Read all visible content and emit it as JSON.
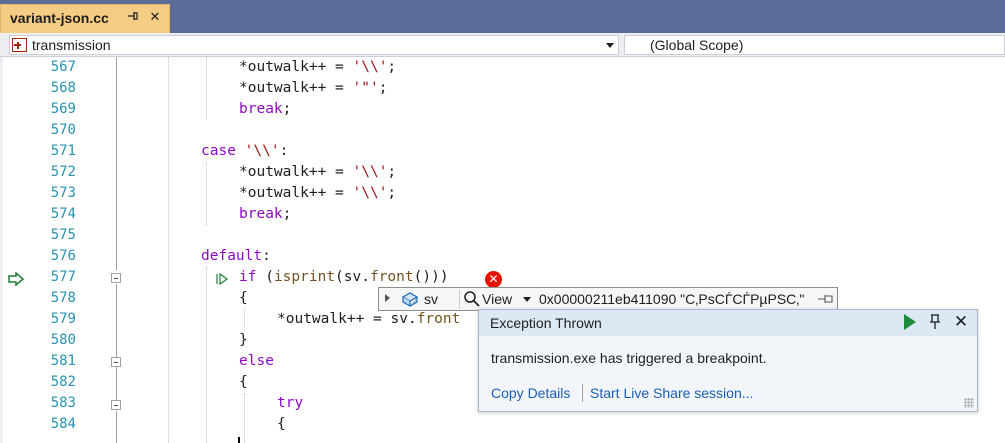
{
  "tab": {
    "title": "variant-json.cc",
    "pin_glyph": "⊣",
    "close_glyph": "✕"
  },
  "navbar": {
    "left_value": "transmission",
    "right_value": "(Global Scope)"
  },
  "line_numbers": [
    "567",
    "568",
    "569",
    "570",
    "571",
    "572",
    "573",
    "574",
    "575",
    "576",
    "577",
    "578",
    "579",
    "580",
    "581",
    "582",
    "583",
    "584"
  ],
  "code": {
    "l567": {
      "a": "*outwalk++ = ",
      "b": "'\\\\'",
      "c": ";"
    },
    "l568": {
      "a": "*outwalk++ = ",
      "b": "'\"'",
      "c": ";"
    },
    "l569": {
      "kw": "break",
      "c": ";"
    },
    "l571": {
      "kw": "case",
      "b": "'\\\\'",
      "c": ":"
    },
    "l572": {
      "a": "*outwalk++ = ",
      "b": "'\\\\'",
      "c": ";"
    },
    "l573": {
      "a": "*outwalk++ = ",
      "b": "'\\\\'",
      "c": ";"
    },
    "l574": {
      "kw": "break",
      "c": ";"
    },
    "l576": {
      "kw": "default",
      "c": ":"
    },
    "l577": {
      "kw": "if",
      "a": " (",
      "fn1": "isprint",
      "b": "(sv.",
      "fn2": "front",
      "c": "()))"
    },
    "l578": {
      "c": "{"
    },
    "l579": {
      "a": "*outwalk++ = sv.",
      "fn": "front"
    },
    "l580": {
      "c": "}"
    },
    "l581": {
      "kw": "else"
    },
    "l582": {
      "c": "{"
    },
    "l583": {
      "kw": "try"
    },
    "l584": {
      "c": "{"
    }
  },
  "datatip": {
    "var_name": "sv",
    "view_label": "View",
    "value": "0x00000211eb411090 \"С‚РѕСЃСЃРµРЅС‚\""
  },
  "exception": {
    "title": "Exception Thrown",
    "message": "transmission.exe has triggered a breakpoint.",
    "link_copy": "Copy Details",
    "link_share": "Start Live Share session..."
  },
  "colors": {
    "keyword": "#8f08c4",
    "string": "#a31515",
    "function": "#74531f",
    "line_number": "#2b91af",
    "tab_active": "#f5cc84",
    "tab_strip": "#5d6b99"
  }
}
